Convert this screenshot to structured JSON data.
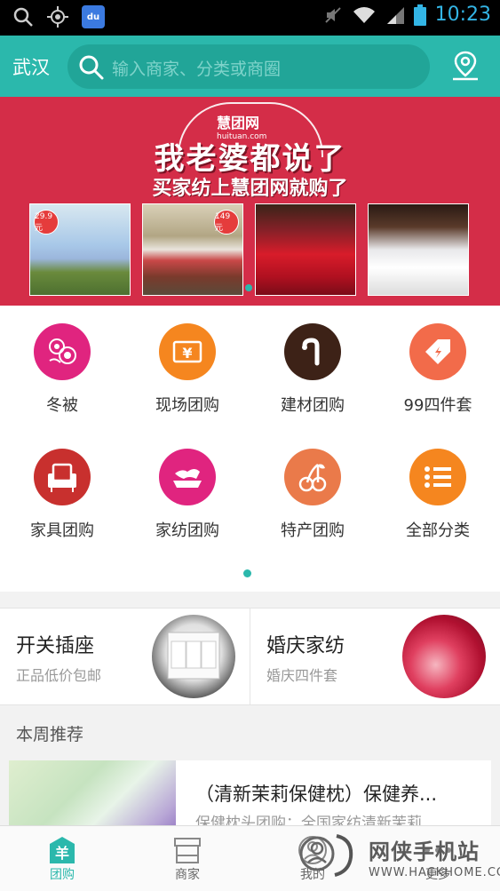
{
  "status_bar": {
    "time": "10:23",
    "baidu_label": "du"
  },
  "header": {
    "city": "武汉",
    "search_placeholder": "输入商家、分类或商圈"
  },
  "banner": {
    "logo_text": "慧团网",
    "logo_url": "huituan.com",
    "headline": "我老婆都说了",
    "subheadline": "买家纺上慧团网就购了",
    "badges": [
      "29.9元",
      "149元"
    ]
  },
  "categories": [
    {
      "label": "冬被",
      "color": "#e0247f",
      "icon": "rose-icon"
    },
    {
      "label": "现场团购",
      "color": "#f5861f",
      "icon": "yen-ticket-icon"
    },
    {
      "label": "建材团购",
      "color": "#3d2217",
      "icon": "faucet-icon"
    },
    {
      "label": "99四件套",
      "color": "#f26b4a",
      "icon": "tag-icon"
    },
    {
      "label": "家具团购",
      "color": "#c8302e",
      "icon": "armchair-icon"
    },
    {
      "label": "家纺团购",
      "color": "#e0247f",
      "icon": "bedding-icon"
    },
    {
      "label": "特产团购",
      "color": "#ea7a4a",
      "icon": "cherry-icon"
    },
    {
      "label": "全部分类",
      "color": "#f5861f",
      "icon": "list-icon"
    }
  ],
  "promos": [
    {
      "title": "开关插座",
      "subtitle": "正品低价包邮"
    },
    {
      "title": "婚庆家纺",
      "subtitle": "婚庆四件套"
    }
  ],
  "section": {
    "title": "本周推荐"
  },
  "recommendation": {
    "title": "（清新茉莉保健枕）保健养...",
    "subtitle": "保健枕头团购：全国家纺清新茉莉"
  },
  "bottom_nav": [
    {
      "label": "团购",
      "active": true
    },
    {
      "label": "商家",
      "active": false
    },
    {
      "label": "我的",
      "active": false
    },
    {
      "label": "更多",
      "active": false
    }
  ],
  "watermark": {
    "text": "网侠手机站",
    "url": "WWW.HACKHOME.COM"
  },
  "colors": {
    "accent": "#2bb8ac",
    "banner": "#d42d48"
  }
}
